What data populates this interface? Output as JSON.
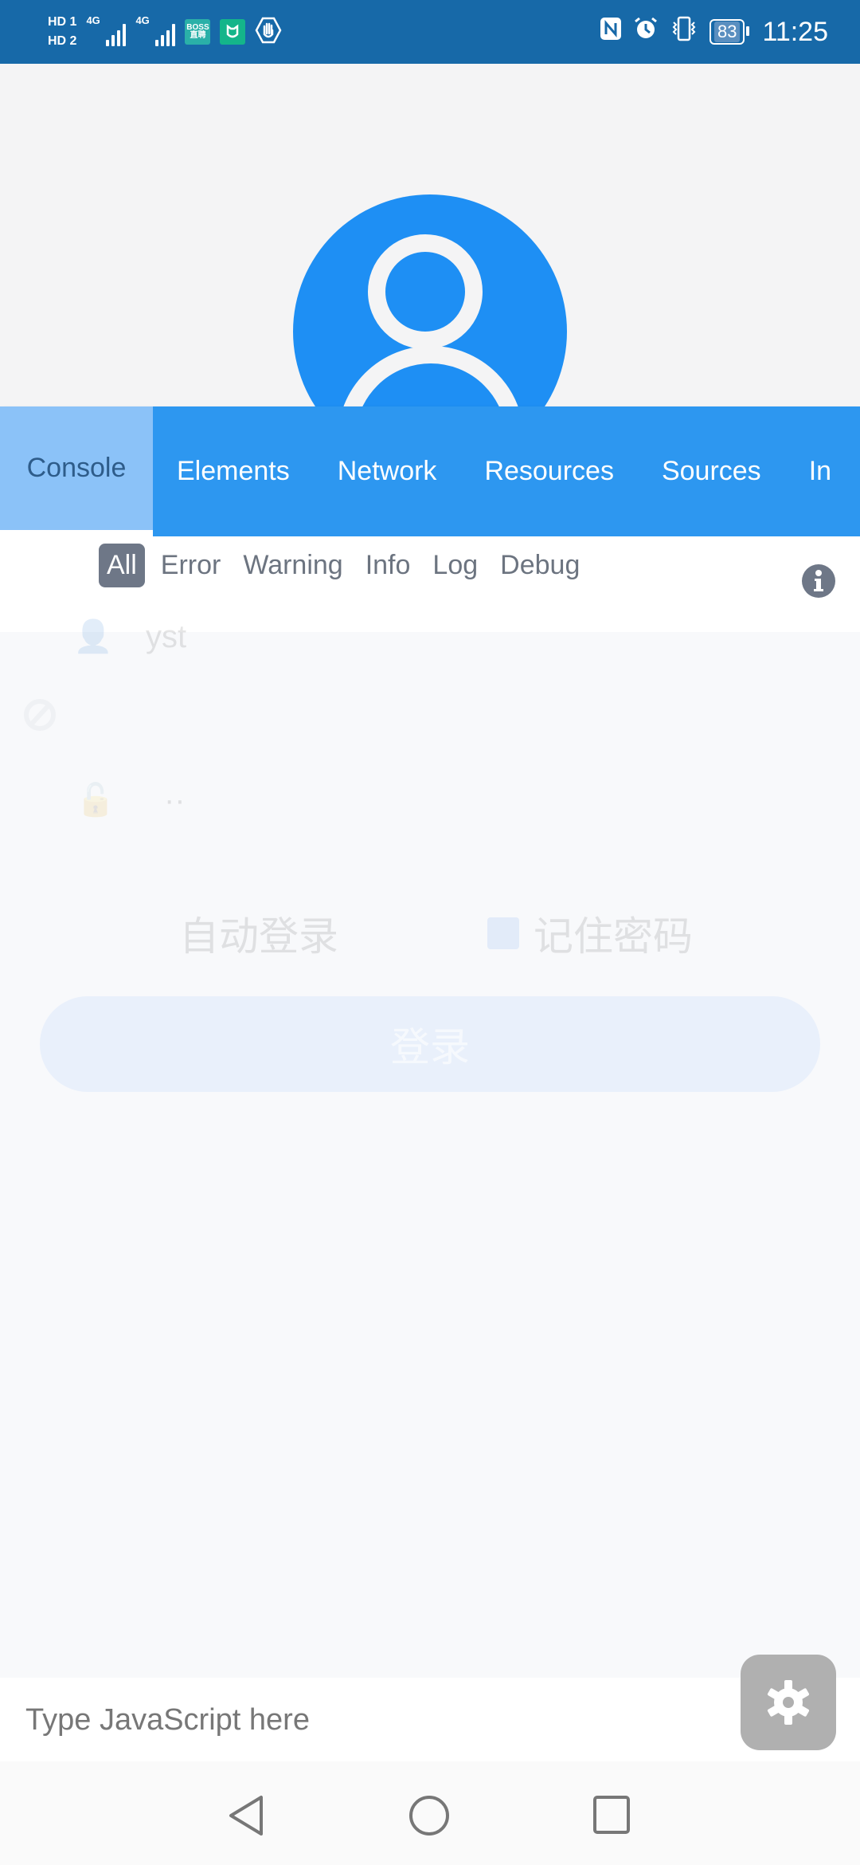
{
  "status_bar": {
    "sim1": "HD 1",
    "sim2": "HD 2",
    "network1": "4G",
    "network2": "4G",
    "apps": [
      {
        "name": "boss-zhipin-icon",
        "label": "BOSS直聘",
        "color": "#2ab0a8"
      },
      {
        "name": "mijia-icon",
        "label": "",
        "color": "#14b58a"
      },
      {
        "name": "hand-stop-icon",
        "label": ""
      }
    ],
    "battery": "83",
    "time": "11:25"
  },
  "background_app": {
    "username_hint": "yst",
    "password_hint": "··",
    "auto_login": "自动登录",
    "remember_password": "记住密码",
    "login_button": "登录",
    "avatar_color": "#1e8ff4"
  },
  "devtools": {
    "tabs": [
      {
        "label": "Console",
        "active": true
      },
      {
        "label": "Elements"
      },
      {
        "label": "Network"
      },
      {
        "label": "Resources"
      },
      {
        "label": "Sources"
      },
      {
        "label": "In"
      }
    ],
    "filters": [
      {
        "label": "All",
        "active": true
      },
      {
        "label": "Error"
      },
      {
        "label": "Warning"
      },
      {
        "label": "Info"
      },
      {
        "label": "Log"
      },
      {
        "label": "Debug"
      }
    ],
    "input_placeholder": "Type JavaScript here",
    "accent_color": "#2d97f0"
  }
}
